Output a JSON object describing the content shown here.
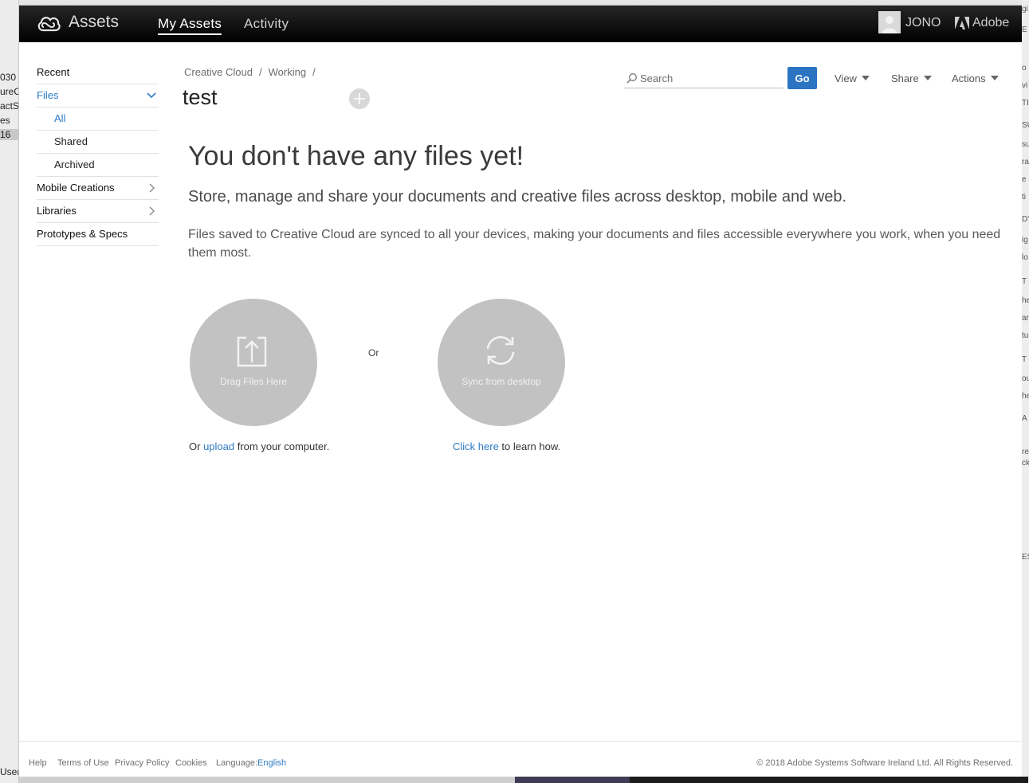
{
  "background": {
    "left_fragments": [
      "030",
      "ureO",
      "actSt",
      "es",
      "16",
      "User"
    ],
    "right_fragments": [
      "gi",
      "E",
      "o",
      "vi",
      "TI",
      "SU",
      "su",
      "ra",
      "e",
      "ti",
      "D'",
      "ig",
      "lo",
      "T",
      "he",
      "ar",
      "tu",
      "T",
      "ou",
      "he",
      "A",
      "re",
      "ck",
      "ES"
    ]
  },
  "topbar": {
    "app_title": "Assets",
    "tabs": [
      {
        "label": "My Assets",
        "active": true
      },
      {
        "label": "Activity",
        "active": false
      }
    ],
    "user_name": "JONO",
    "brand": "Adobe"
  },
  "sidebar": {
    "items": [
      {
        "label": "Recent"
      },
      {
        "label": "Files"
      }
    ],
    "sub_items": [
      {
        "label": "All"
      },
      {
        "label": "Shared"
      },
      {
        "label": "Archived"
      }
    ],
    "bottom_items": [
      {
        "label": "Mobile Creations"
      },
      {
        "label": "Libraries"
      },
      {
        "label": "Prototypes & Specs"
      }
    ]
  },
  "breadcrumb": {
    "items": [
      "Creative Cloud",
      "Working"
    ],
    "separator": "/"
  },
  "folder_title": "test",
  "toolbar": {
    "search_placeholder": "Search",
    "go_label": "Go",
    "view_label": "View",
    "share_label": "Share",
    "actions_label": "Actions"
  },
  "empty_state": {
    "headline": "You don't have any files yet!",
    "subhead": "Store, manage and share your documents and creative files across desktop, mobile and web.",
    "description": "Files saved to Creative Cloud are synced to all your devices, making your documents and files accessible everywhere you work, when you need them most.",
    "drag_label": "Drag Files Here",
    "or_label": "Or",
    "sync_label": "Sync from desktop",
    "upload_caption_pre": "Or ",
    "upload_link": "upload",
    "upload_caption_post": " from your computer.",
    "learn_link": "Click here",
    "learn_caption_post": " to learn how."
  },
  "footer": {
    "links": [
      "Help",
      "Terms of Use",
      "Privacy Policy",
      "Cookies"
    ],
    "language_label": "Language:",
    "language_value": "English",
    "copyright": "© 2018 Adobe Systems Software Ireland Ltd. All Rights Reserved."
  },
  "colors": {
    "accent": "#2d7bc4",
    "go_button": "#2b74c1",
    "topbar": "#000000",
    "circle": "#c2c2c2"
  }
}
